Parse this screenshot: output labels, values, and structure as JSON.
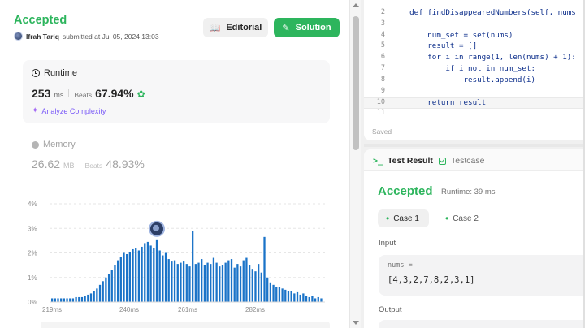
{
  "submission": {
    "status": "Accepted",
    "author": "Ifrah Tariq",
    "submitted_text": "submitted at Jul 05, 2024 13:03",
    "editorial_label": "Editorial",
    "solution_label": "Solution"
  },
  "runtime": {
    "label": "Runtime",
    "value": "253",
    "unit": "ms",
    "beats_label": "Beats",
    "beats_value": "67.94%",
    "analyze_label": "Analyze Complexity"
  },
  "memory": {
    "label": "Memory",
    "value": "26.62",
    "unit": "MB",
    "beats_label": "Beats",
    "beats_value": "48.93%"
  },
  "chart_data": {
    "type": "bar",
    "title": "",
    "xlabel": "",
    "ylabel": "",
    "y_ticks": [
      "4%",
      "3%",
      "2%",
      "1%",
      "0%"
    ],
    "x_ticks": [
      "219ms",
      "240ms",
      "261ms",
      "282ms"
    ],
    "ylim": [
      0,
      4
    ],
    "highlight_bar_index": 35,
    "values": [
      0.15,
      0.15,
      0.15,
      0.15,
      0.15,
      0.15,
      0.15,
      0.15,
      0.2,
      0.2,
      0.2,
      0.25,
      0.3,
      0.35,
      0.45,
      0.55,
      0.7,
      0.85,
      1.0,
      1.15,
      1.3,
      1.5,
      1.7,
      1.85,
      2.0,
      1.95,
      2.05,
      2.15,
      2.2,
      2.1,
      2.25,
      2.4,
      2.45,
      2.3,
      2.2,
      2.55,
      2.1,
      1.9,
      2.0,
      1.75,
      1.65,
      1.7,
      1.55,
      1.6,
      1.65,
      1.55,
      1.45,
      2.9,
      1.55,
      1.6,
      1.75,
      1.5,
      1.6,
      1.55,
      1.8,
      1.6,
      1.45,
      1.5,
      1.6,
      1.7,
      1.75,
      1.4,
      1.55,
      1.45,
      1.7,
      1.8,
      1.5,
      1.35,
      1.25,
      1.55,
      1.2,
      2.65,
      1.0,
      0.8,
      0.7,
      0.6,
      0.6,
      0.55,
      0.5,
      0.45,
      0.45,
      0.35,
      0.4,
      0.3,
      0.35,
      0.25,
      0.2,
      0.25,
      0.15,
      0.2,
      0.15
    ],
    "bar_color": "#1a73c8"
  },
  "editor": {
    "lines": [
      {
        "n": "2",
        "text": "    def findDisappearedNumbers(self, nums"
      },
      {
        "n": "3",
        "text": ""
      },
      {
        "n": "4",
        "text": "        num_set = set(nums)"
      },
      {
        "n": "5",
        "text": "        result = []"
      },
      {
        "n": "6",
        "text": "        for i in range(1, len(nums) + 1):"
      },
      {
        "n": "7",
        "text": "            if i not in num_set:"
      },
      {
        "n": "8",
        "text": "                result.append(i)"
      },
      {
        "n": "9",
        "text": ""
      },
      {
        "n": "10",
        "text": "        return result"
      },
      {
        "n": "11",
        "text": ""
      }
    ],
    "saved_label": "Saved"
  },
  "test_result": {
    "tab_result": "Test Result",
    "tab_testcase": "Testcase",
    "status": "Accepted",
    "runtime_text": "Runtime: 39 ms",
    "case1": "Case 1",
    "case2": "Case 2",
    "input_label": "Input",
    "input_name": "nums =",
    "input_value": "[4,3,2,7,8,2,3,1]",
    "output_label": "Output"
  }
}
